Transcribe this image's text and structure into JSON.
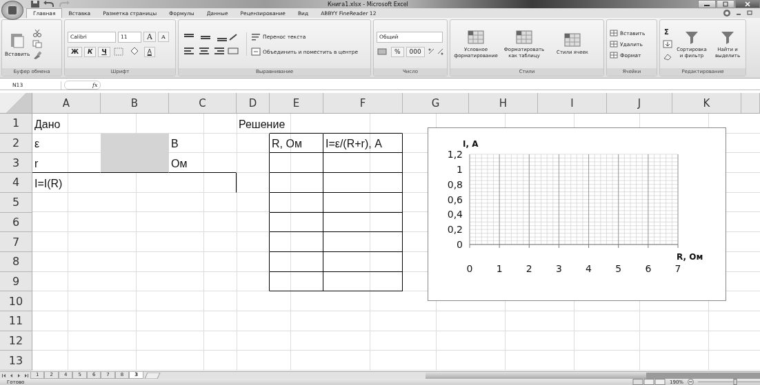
{
  "window": {
    "title": "Книга1.xlsx - Microsoft Excel"
  },
  "ribbon_tabs": [
    {
      "label": "Главная",
      "selected": true
    },
    {
      "label": "Вставка",
      "selected": false
    },
    {
      "label": "Разметка страницы",
      "selected": false
    },
    {
      "label": "Формулы",
      "selected": false
    },
    {
      "label": "Данные",
      "selected": false
    },
    {
      "label": "Рецензирование",
      "selected": false
    },
    {
      "label": "Вид",
      "selected": false
    },
    {
      "label": "ABBYY FineReader 12",
      "selected": false
    }
  ],
  "ribbon": {
    "clipboard": {
      "paste": "Вставить",
      "label": "Буфер обмена"
    },
    "font": {
      "name": "Calibri",
      "size": "11",
      "grow": "A",
      "shrink": "A",
      "bold": "Ж",
      "italic": "К",
      "underline": "Ч",
      "font_color": "A",
      "label": "Шрифт"
    },
    "alignment": {
      "wrap": "Перенос текста",
      "merge": "Объединить и поместить в центре",
      "label": "Выравнивание"
    },
    "number": {
      "format": "Общий",
      "percent": "%",
      "thousands": "000",
      "label": "Число"
    },
    "styles": {
      "buttons": [
        "Условное форматирование",
        "Форматировать как таблицу",
        "Стили ячеек"
      ],
      "label": "Стили"
    },
    "cells": {
      "buttons": [
        "Вставить",
        "Удалить",
        "Формат"
      ],
      "label": "Ячейки"
    },
    "editing": {
      "sum": "Σ",
      "buttons": [
        "Сортировка и фильтр",
        "Найти и выделить"
      ],
      "label": "Редактирование"
    }
  },
  "formula_bar": {
    "name_box": "N13",
    "fx": "fx"
  },
  "sheet": {
    "columns": [
      "A",
      "B",
      "C",
      "D",
      "E",
      "F",
      "G",
      "H",
      "I",
      "J",
      "K"
    ],
    "rows": [
      {
        "label": "1",
        "cells": [
          {
            "text": "Дано"
          },
          {},
          {},
          {
            "text": "Решение"
          }
        ]
      },
      {
        "label": "2",
        "cells": [
          {
            "text": "ε"
          },
          {
            "shaded": true
          },
          {
            "text": "В"
          },
          {},
          {
            "text": "R, Ом"
          },
          {
            "text": "I=ε/(R+r), А"
          }
        ]
      },
      {
        "label": "3",
        "cells": [
          {
            "text": "r"
          },
          {
            "shaded": true
          },
          {
            "text": "Ом"
          }
        ]
      },
      {
        "label": "4",
        "cells": [
          {
            "text": "I=I(R)"
          }
        ]
      },
      {
        "label": "5"
      },
      {
        "label": "6"
      },
      {
        "label": "7"
      },
      {
        "label": "8"
      },
      {
        "label": "9"
      },
      {
        "label": "10"
      },
      {
        "label": "11"
      },
      {
        "label": "12"
      },
      {
        "label": "13"
      }
    ],
    "chart_data": {
      "type": "line",
      "grid": true,
      "xlabel": "R, Ом",
      "ylabel": "I, А",
      "xlim": [
        0,
        7
      ],
      "ylim": [
        0,
        1.2
      ],
      "xticks": [
        0,
        1,
        2,
        3,
        4,
        5,
        6,
        7
      ],
      "yticks": [
        {
          "value": 0,
          "label": "0"
        },
        {
          "value": 0.2,
          "label": "0,2"
        },
        {
          "value": 0.4,
          "label": "0,4"
        },
        {
          "value": 0.6,
          "label": "0,6"
        },
        {
          "value": 0.8,
          "label": "0,8"
        },
        {
          "value": 1,
          "label": "1"
        },
        {
          "value": 1.2,
          "label": "1,2"
        }
      ]
    }
  },
  "sheet_tabs": [
    {
      "label": "1",
      "selected": false
    },
    {
      "label": "2",
      "selected": false
    },
    {
      "label": "4",
      "selected": false
    },
    {
      "label": "5",
      "selected": false
    },
    {
      "label": "6",
      "selected": false
    },
    {
      "label": "7",
      "selected": false
    },
    {
      "label": "8",
      "selected": false
    },
    {
      "label": "3",
      "selected": true
    }
  ],
  "status_bar": {
    "text": "Готово",
    "zoom": "190%",
    "level": 0.6
  }
}
